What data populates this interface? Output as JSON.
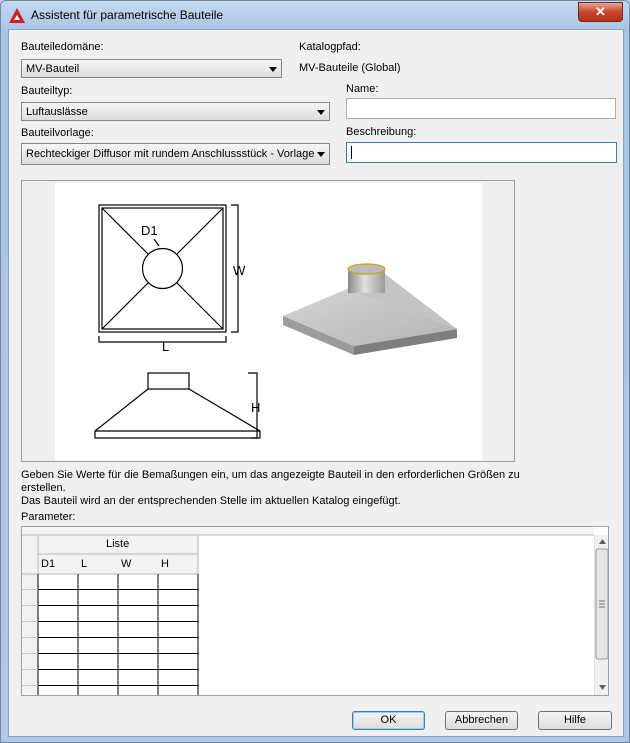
{
  "window": {
    "title": "Assistent für parametrische Bauteile",
    "close_glyph": "✕"
  },
  "form": {
    "domain_label": "Bauteiledomäne:",
    "domain_value": "MV-Bauteil",
    "catalog_label": "Katalogpfad:",
    "catalog_value": "MV-Bauteile (Global)",
    "type_label": "Bauteiltyp:",
    "type_value": "Luftauslässe",
    "name_label": "Name:",
    "name_value": "",
    "template_label": "Bauteilvorlage:",
    "template_value": "Rechteckiger Diffusor mit rundem Anschlussstück - Vorlage",
    "desc_label": "Beschreibung:",
    "desc_value": ""
  },
  "preview": {
    "labels": {
      "d1": "D1",
      "w": "W",
      "l": "L",
      "h": "H"
    }
  },
  "info": {
    "line1": "Geben Sie Werte für die Bemaßungen ein, um das angezeigte Bauteil in den erforderlichen Größen zu",
    "line2": "erstellen.",
    "line3": "Das Bauteil wird an der entsprechenden Stelle im aktuellen Katalog eingefügt."
  },
  "parameters": {
    "label": "Parameter:",
    "group_header": "Liste",
    "columns": [
      "D1",
      "L",
      "W",
      "H"
    ]
  },
  "buttons": {
    "ok": "OK",
    "cancel": "Abbrechen",
    "help": "Hilfe"
  }
}
